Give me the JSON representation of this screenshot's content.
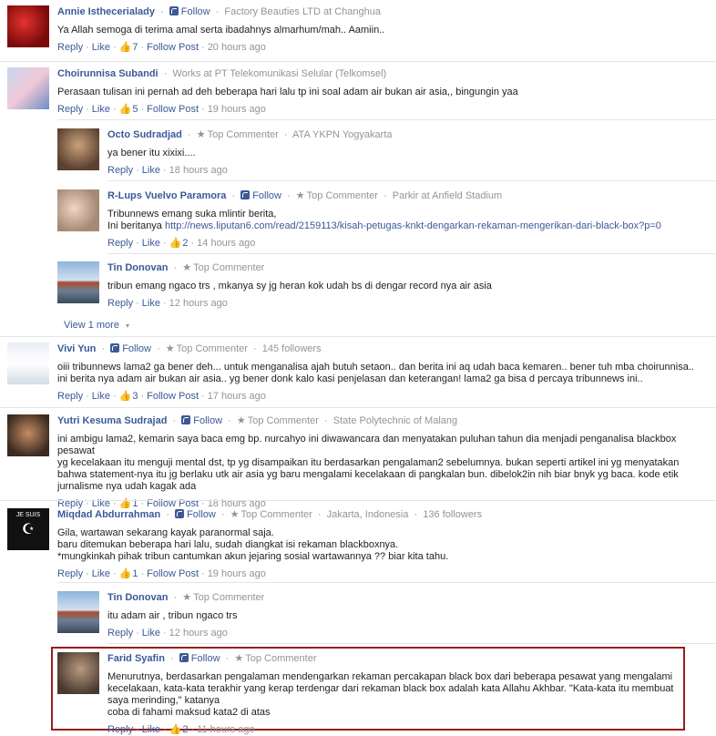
{
  "comments": [
    {
      "name": "Annie Isthecerialady",
      "follow": "Follow",
      "meta": "Factory Beauties LTD at Changhua",
      "text": "Ya Allah semoga di terima amal serta ibadahnys almarhum/mah.. Aamiin..",
      "reply": "Reply",
      "like": "Like",
      "likes": "7",
      "follow_post": "Follow Post",
      "time": "20 hours ago"
    },
    {
      "name": "Choirunnisa Subandi",
      "meta": "Works at PT Telekomunikasi Selular (Telkomsel)",
      "text": "Perasaan tulisan ini pernah ad deh beberapa hari lalu tp ini soal adam air bukan air asia,, bingungin yaa",
      "reply": "Reply",
      "like": "Like",
      "likes": "5",
      "follow_post": "Follow Post",
      "time": "19 hours ago"
    },
    {
      "name": "Octo Sudradjad",
      "badge": "Top Commenter",
      "meta": "ATA YKPN Yogyakarta",
      "text": "ya bener itu xixixi....",
      "reply": "Reply",
      "like": "Like",
      "time": "18 hours ago"
    },
    {
      "name": "R-Lups Vuelvo Paramora",
      "follow": "Follow",
      "badge": "Top Commenter",
      "meta": "Parkir at Anfield Stadium",
      "text1": "Tribunnews emang suka mlintir berita,",
      "text2_prefix": "Ini beritanya ",
      "link": "http://news.liputan6.com/read/2159113/kisah-petugas-knkt-dengarkan-rekaman-mengerikan-dari-black-box?p=0",
      "reply": "Reply",
      "like": "Like",
      "likes": "2",
      "time": "14 hours ago"
    },
    {
      "name": "Tin Donovan",
      "badge": "Top Commenter",
      "text": "tribun emang ngaco trs , mkanya sy jg heran kok udah bs di dengar record nya air asia",
      "reply": "Reply",
      "like": "Like",
      "time": "12 hours ago"
    },
    {
      "name": "Vivi Yun",
      "follow": "Follow",
      "badge": "Top Commenter",
      "meta": "145 followers",
      "text1": "oiii tribunnews lama2 ga bener deh... untuk menganalisa ajah butuh setaon.. dan berita ini aq udah baca kemaren.. bener tuh mba choirunnisa..",
      "text2": "ini berita nya adam air bukan air asia.. yg bener donk kalo kasi penjelasan dan keterangan! lama2 ga bisa d percaya tribunnews ini..",
      "reply": "Reply",
      "like": "Like",
      "likes": "3",
      "follow_post": "Follow Post",
      "time": "17 hours ago"
    },
    {
      "name": "Yutri Kesuma Sudrajad",
      "follow": "Follow",
      "badge": "Top Commenter",
      "meta": "State Polytechnic of Malang",
      "text1": "ini ambigu lama2, kemarin saya baca emg bp. nurcahyo ini diwawancara dan menyatakan puluhan tahun dia menjadi penganalisa blackbox pesawat",
      "text2": "yg kecelakaan itu menguji mental dst, tp yg disampaikan itu berdasarkan pengalaman2 sebelumnya. bukan seperti artikel ini yg menyatakan",
      "text3": "bahwa statement-nya itu jg berlaku utk air asia yg baru mengalami kecelakaan di pangkalan bun. dibelok2in nih biar bnyk yg baca. kode etik",
      "text4": "jurnalisme nya udah kagak ada",
      "reply": "Reply",
      "like": "Like",
      "likes": "1",
      "follow_post": "Follow Post",
      "time": "18 hours ago"
    },
    {
      "name": "Miqdad Abdurrahman",
      "follow": "Follow",
      "badge": "Top Commenter",
      "meta1": "Jakarta, Indonesia",
      "meta2": "136 followers",
      "text1": "Gila, wartawan sekarang kayak paranormal saja.",
      "text2": "baru ditemukan beberapa hari lalu, sudah diangkat isi rekaman blackboxnya.",
      "text3": "*mungkinkah pihak tribun cantumkan akun jejaring sosial wartawannya ?? biar kita tahu.",
      "reply": "Reply",
      "like": "Like",
      "likes": "1",
      "follow_post": "Follow Post",
      "time": "19 hours ago",
      "avatar_text": "JE SUIS"
    },
    {
      "name": "Tin Donovan",
      "badge": "Top Commenter",
      "text": "itu adam air , tribun ngaco trs",
      "reply": "Reply",
      "like": "Like",
      "time": "12 hours ago"
    },
    {
      "name": "Farid Syafin",
      "follow": "Follow",
      "badge": "Top Commenter",
      "text1": "Menurutnya, berdasarkan pengalaman mendengarkan rekaman percakapan black box dari beberapa pesawat yang mengalami",
      "text2": "kecelakaan, kata-kata terakhir yang kerap terdengar dari rekaman black box adalah kata Allahu Akhbar. \"Kata-kata itu membuat",
      "text3": "saya merinding,\" katanya",
      "text4": "coba di fahami maksud kata2 di atas",
      "reply": "Reply",
      "like": "Like",
      "likes": "2",
      "time": "11 hours ago"
    }
  ],
  "view_more": "View 1 more",
  "colors": {
    "link": "#3b5998",
    "muted": "#90949c",
    "highlight": "#9b1c1c"
  }
}
